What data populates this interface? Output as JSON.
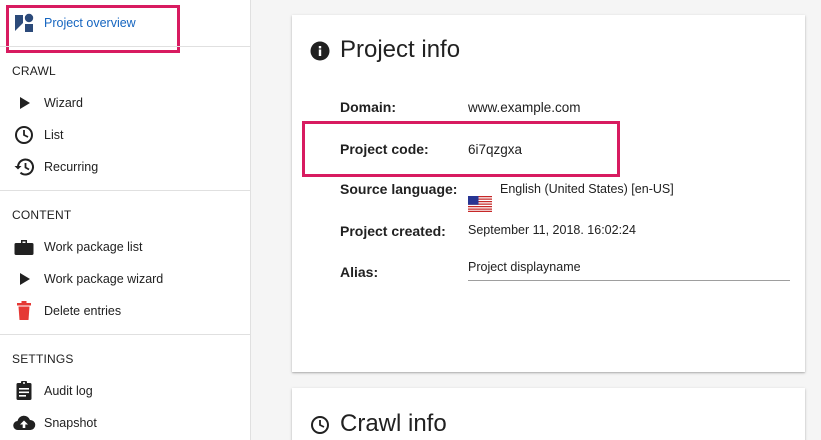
{
  "sidebar": {
    "overview": {
      "label": "Project overview",
      "icon": "project-overview-icon"
    },
    "sections": {
      "crawl": {
        "title": "CRAWL",
        "items": [
          {
            "label": "Wizard",
            "icon": "play-icon"
          },
          {
            "label": "List",
            "icon": "clock-icon"
          },
          {
            "label": "Recurring",
            "icon": "history-icon"
          }
        ]
      },
      "content": {
        "title": "CONTENT",
        "items": [
          {
            "label": "Work package list",
            "icon": "briefcase-icon"
          },
          {
            "label": "Work package wizard",
            "icon": "play-icon"
          },
          {
            "label": "Delete entries",
            "icon": "trash-icon"
          }
        ]
      },
      "settings": {
        "title": "SETTINGS",
        "items": [
          {
            "label": "Audit log",
            "icon": "assignment-icon"
          },
          {
            "label": "Snapshot",
            "icon": "cloud-upload-icon"
          }
        ]
      }
    }
  },
  "project_info": {
    "title": "Project info",
    "icon": "info-icon",
    "domain_label": "Domain:",
    "domain_value": "www.example.com",
    "code_label": "Project code:",
    "code_value": "6i7qzgxa",
    "source_language_label": "Source language:",
    "source_language_value": "English (United States) [en-US]",
    "source_language_flag": "us-flag-icon",
    "created_label": "Project created:",
    "created_value": "September 11, 2018. 16:02:24",
    "alias_label": "Alias:",
    "alias_value": "Project displayname"
  },
  "crawl_info": {
    "title": "Crawl info",
    "icon": "clock-icon"
  },
  "colors": {
    "highlight": "#d81b60",
    "active_link": "#1565c0",
    "delete_icon": "#e53935",
    "overview_icon": "#2c4a7a"
  }
}
